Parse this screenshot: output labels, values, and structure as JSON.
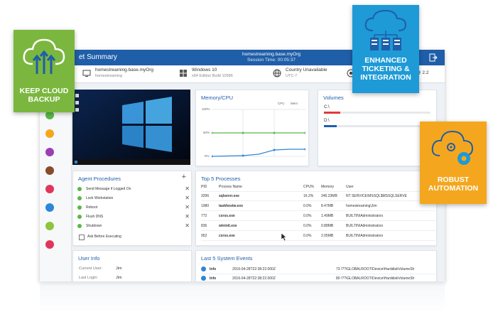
{
  "app": {
    "title": "et Summary",
    "machine": "homestreaming.base.myOrg",
    "session": "Session Time: 00:05:37",
    "exit_icon": "exit-icon"
  },
  "infobar": {
    "machine_name": "homestreaming.base.myOrg",
    "machine_sub": "homestreaming",
    "os_name": "Windows 10",
    "os_sub": "x64 Edition Build 10586",
    "country": "Country Unavailable",
    "timezone": "UTC-7",
    "right_text": "@ 2.2"
  },
  "memory_cpu": {
    "title": "Memory/CPU",
    "legend": [
      "CPU",
      "Mem"
    ],
    "y_ticks": [
      "100%",
      "50%",
      "0%"
    ],
    "colors": {
      "cpu": "#2e86d6",
      "mem": "#58b947"
    }
  },
  "volumes": {
    "title": "Volumes",
    "drives": [
      {
        "label": "C:\\",
        "fill": 0.15,
        "color": "#e03a3a"
      },
      {
        "label": "D:\\",
        "fill": 0.12,
        "color": "#1f5ea8"
      }
    ]
  },
  "agent_procedures": {
    "title": "Agent Procedures",
    "add": "+",
    "items": [
      "Send Message if Logged On",
      "Lock Workstation",
      "Reboot",
      "Flush DNS",
      "Shutdown"
    ],
    "checkbox_label": "Ask Before Executing"
  },
  "top_processes": {
    "title": "Top 5 Processes",
    "headers": [
      "PID",
      "Process Name",
      "CPU%",
      "Memory",
      "User"
    ],
    "rows": [
      [
        "3296",
        "sqlservr.exe",
        "16.2%",
        "246.23MB",
        "NT SERVICE\\MSSQL$MSSQLSERVE"
      ],
      [
        "1980",
        "taskhostw.exe",
        "0.0%",
        "8.47MB",
        "homestreaming\\Jim"
      ],
      [
        "772",
        "csrss.exe",
        "0.0%",
        "1.49MB",
        "BUILTIN\\Administrators"
      ],
      [
        "836",
        "wininit.exe",
        "0.0%",
        "0.88MB",
        "BUILTIN\\Administrators"
      ],
      [
        "952",
        "csrss.exe",
        "0.0%",
        "2.05MB",
        "BUILTIN\\Administrators"
      ]
    ]
  },
  "user_info": {
    "title": "User Info",
    "rows": [
      [
        "Current User:",
        "Jim"
      ],
      [
        "Last Login:",
        "Jim"
      ]
    ]
  },
  "system_events": {
    "title": "Last 5 System Events",
    "rows": [
      [
        "Info",
        "2016-04-28T22:38:22.000Z",
        "73 \\??\\GLOBALROOT\\Device\\HarddiskVolumeSh"
      ],
      [
        "Info",
        "2016-04-28T22:38:22.000Z",
        "80 \\??\\GLOBALROOT\\Device\\HarddiskVolumeSh"
      ]
    ]
  },
  "badges": {
    "keep_cloud": {
      "label": "KEEP CLOUD BACKUP",
      "color": "#7bb73e"
    },
    "ticketing": {
      "label": "ENHANCED TICKETING & INTEGRATION",
      "color": "#1e9ad6"
    },
    "automation": {
      "label": "ROBUST AUTOMATION",
      "color": "#f4a71e"
    }
  }
}
